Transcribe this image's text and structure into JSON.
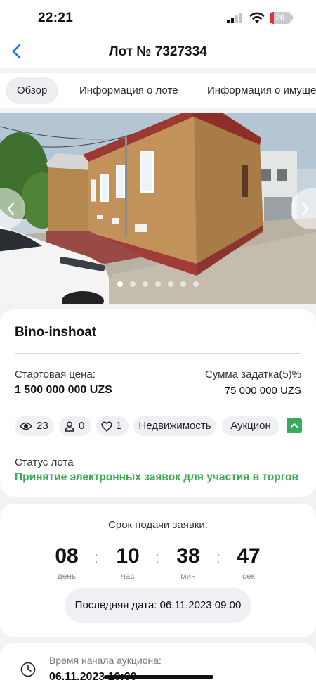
{
  "status_bar": {
    "time": "22:21",
    "battery": "20",
    "battery_level": 0.2
  },
  "header": {
    "title": "Лот № 7327334",
    "back_icon": "chevron-left-icon"
  },
  "tabs": [
    {
      "label": "Обзор",
      "active": true
    },
    {
      "label": "Информация о лоте",
      "active": false
    },
    {
      "label": "Информация о имуще",
      "active": false
    }
  ],
  "gallery": {
    "photo_count": 7,
    "current_index": 0
  },
  "lot": {
    "name": "Bino-inshoat",
    "start_price_label": "Стартовая цена:",
    "start_price": "1 500 000 000 UZS",
    "deposit_label": "Сумма задатка(5)%",
    "deposit": "75 000 000 UZS",
    "views": "23",
    "participants": "0",
    "favorites": "1",
    "category": "Недвижимость",
    "type": "Аукцион",
    "status_label": "Статус лота",
    "status_value": "Принятие электронных заявок для участия в торгов"
  },
  "deadline": {
    "label": "Срок подачи заявки:",
    "days": "08",
    "days_unit": "день",
    "hours": "10",
    "hours_unit": "час",
    "minutes": "38",
    "minutes_unit": "мин",
    "seconds": "47",
    "seconds_unit": "сек",
    "last_date": "Последняя дата: 06.11.2023 09:00"
  },
  "auction": {
    "start_label": "Время начала аукциона:",
    "start_value": "06.11.2023 10:00"
  },
  "colors": {
    "accent_blue": "#1a73e8",
    "status_green": "#3aa852",
    "battery_red": "#e0323a"
  }
}
